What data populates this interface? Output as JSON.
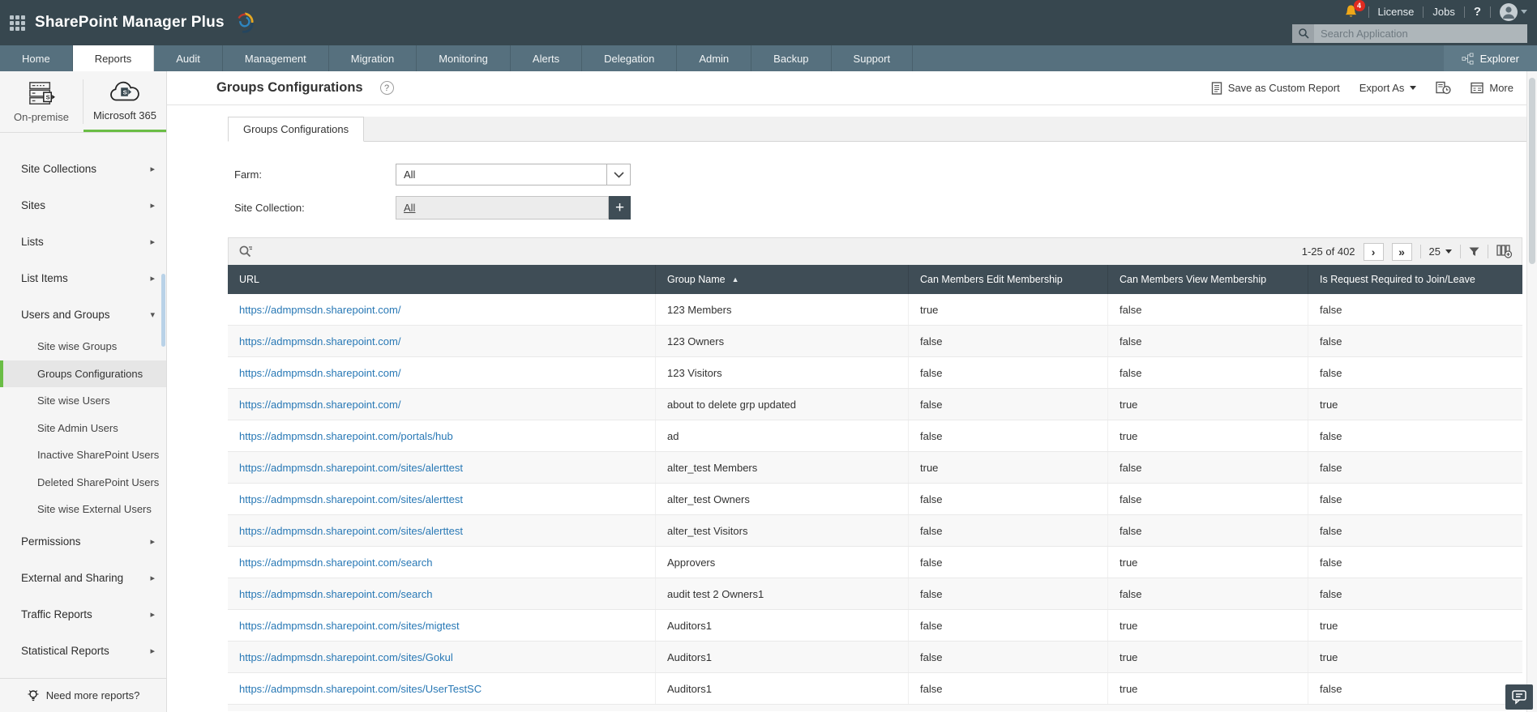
{
  "colors": {
    "accent_green": "#6abd45",
    "link_blue": "#2878b5",
    "topbar_dark": "#37474f",
    "nav_gray": "#56707e",
    "table_header": "#3f4d56",
    "badge_red": "#e02b20",
    "bell_yellow": "#f0a818"
  },
  "glyphs": {
    "collapsed_arrow": "▸",
    "expanded_arrow": "▾",
    "sort_asc": "▲",
    "next_page": "›",
    "last_page": "»"
  },
  "topbar": {
    "logo": "SharePoint Manager Plus",
    "notifications_badge": "4",
    "license_label": "License",
    "jobs_label": "Jobs",
    "help_label": "?",
    "search_placeholder": "Search Application"
  },
  "nav": {
    "tabs": [
      {
        "label": "Home"
      },
      {
        "label": "Reports",
        "active": true
      },
      {
        "label": "Audit"
      },
      {
        "label": "Management"
      },
      {
        "label": "Migration"
      },
      {
        "label": "Monitoring"
      },
      {
        "label": "Alerts"
      },
      {
        "label": "Delegation"
      },
      {
        "label": "Admin"
      },
      {
        "label": "Backup"
      },
      {
        "label": "Support"
      }
    ],
    "explorer_label": "Explorer"
  },
  "sidebar": {
    "environments": [
      {
        "label": "On-premise"
      },
      {
        "label": "Microsoft 365",
        "active": true
      }
    ],
    "menu": [
      {
        "label": "Site Collections",
        "expandable": true
      },
      {
        "label": "Sites",
        "expandable": true
      },
      {
        "label": "Lists",
        "expandable": true
      },
      {
        "label": "List Items",
        "expandable": true
      },
      {
        "label": "Users and Groups",
        "expandable": true,
        "expanded": true,
        "children": [
          {
            "label": "Site wise Groups"
          },
          {
            "label": "Groups Configurations",
            "active": true
          },
          {
            "label": "Site wise Users"
          },
          {
            "label": "Site Admin Users"
          },
          {
            "label": "Inactive SharePoint Users"
          },
          {
            "label": "Deleted SharePoint Users"
          },
          {
            "label": "Site wise External Users"
          }
        ]
      },
      {
        "label": "Permissions",
        "expandable": true
      },
      {
        "label": "External and Sharing",
        "expandable": true
      },
      {
        "label": "Traffic Reports",
        "expandable": true
      },
      {
        "label": "Statistical Reports",
        "expandable": true
      }
    ],
    "footer": "Need more reports?"
  },
  "report": {
    "title": "Groups Configurations",
    "help": "?",
    "actions": {
      "save": "Save as Custom Report",
      "export": "Export As",
      "more": "More"
    },
    "tab": "Groups Configurations",
    "filters": {
      "farm_label": "Farm:",
      "farm_value": "All",
      "site_collection_label": "Site Collection:",
      "site_collection_value": "All",
      "add_button": "+"
    }
  },
  "table": {
    "pagination": {
      "range": "1-25 of 402",
      "page_size": "25"
    },
    "columns": [
      {
        "label": "URL"
      },
      {
        "label": "Group Name",
        "sorted": "asc"
      },
      {
        "label": "Can Members Edit Membership"
      },
      {
        "label": "Can Members View Membership"
      },
      {
        "label": "Is Request Required to Join/Leave"
      }
    ],
    "rows": [
      {
        "url": "https://admpmsdn.sharepoint.com/",
        "group": "123 Members",
        "edit": "true",
        "view": "false",
        "request": "false"
      },
      {
        "url": "https://admpmsdn.sharepoint.com/",
        "group": "123 Owners",
        "edit": "false",
        "view": "false",
        "request": "false"
      },
      {
        "url": "https://admpmsdn.sharepoint.com/",
        "group": "123 Visitors",
        "edit": "false",
        "view": "false",
        "request": "false"
      },
      {
        "url": "https://admpmsdn.sharepoint.com/",
        "group": "about to delete grp updated",
        "edit": "false",
        "view": "true",
        "request": "true"
      },
      {
        "url": "https://admpmsdn.sharepoint.com/portals/hub",
        "group": "ad",
        "edit": "false",
        "view": "true",
        "request": "false"
      },
      {
        "url": "https://admpmsdn.sharepoint.com/sites/alerttest",
        "group": "alter_test Members",
        "edit": "true",
        "view": "false",
        "request": "false"
      },
      {
        "url": "https://admpmsdn.sharepoint.com/sites/alerttest",
        "group": "alter_test Owners",
        "edit": "false",
        "view": "false",
        "request": "false"
      },
      {
        "url": "https://admpmsdn.sharepoint.com/sites/alerttest",
        "group": "alter_test Visitors",
        "edit": "false",
        "view": "false",
        "request": "false"
      },
      {
        "url": "https://admpmsdn.sharepoint.com/search",
        "group": "Approvers",
        "edit": "false",
        "view": "true",
        "request": "false"
      },
      {
        "url": "https://admpmsdn.sharepoint.com/search",
        "group": "audit test 2 Owners1",
        "edit": "false",
        "view": "false",
        "request": "false"
      },
      {
        "url": "https://admpmsdn.sharepoint.com/sites/migtest",
        "group": "Auditors1",
        "edit": "false",
        "view": "true",
        "request": "true"
      },
      {
        "url": "https://admpmsdn.sharepoint.com/sites/Gokul",
        "group": "Auditors1",
        "edit": "false",
        "view": "true",
        "request": "true"
      },
      {
        "url": "https://admpmsdn.sharepoint.com/sites/UserTestSC",
        "group": "Auditors1",
        "edit": "false",
        "view": "true",
        "request": "false"
      }
    ]
  }
}
